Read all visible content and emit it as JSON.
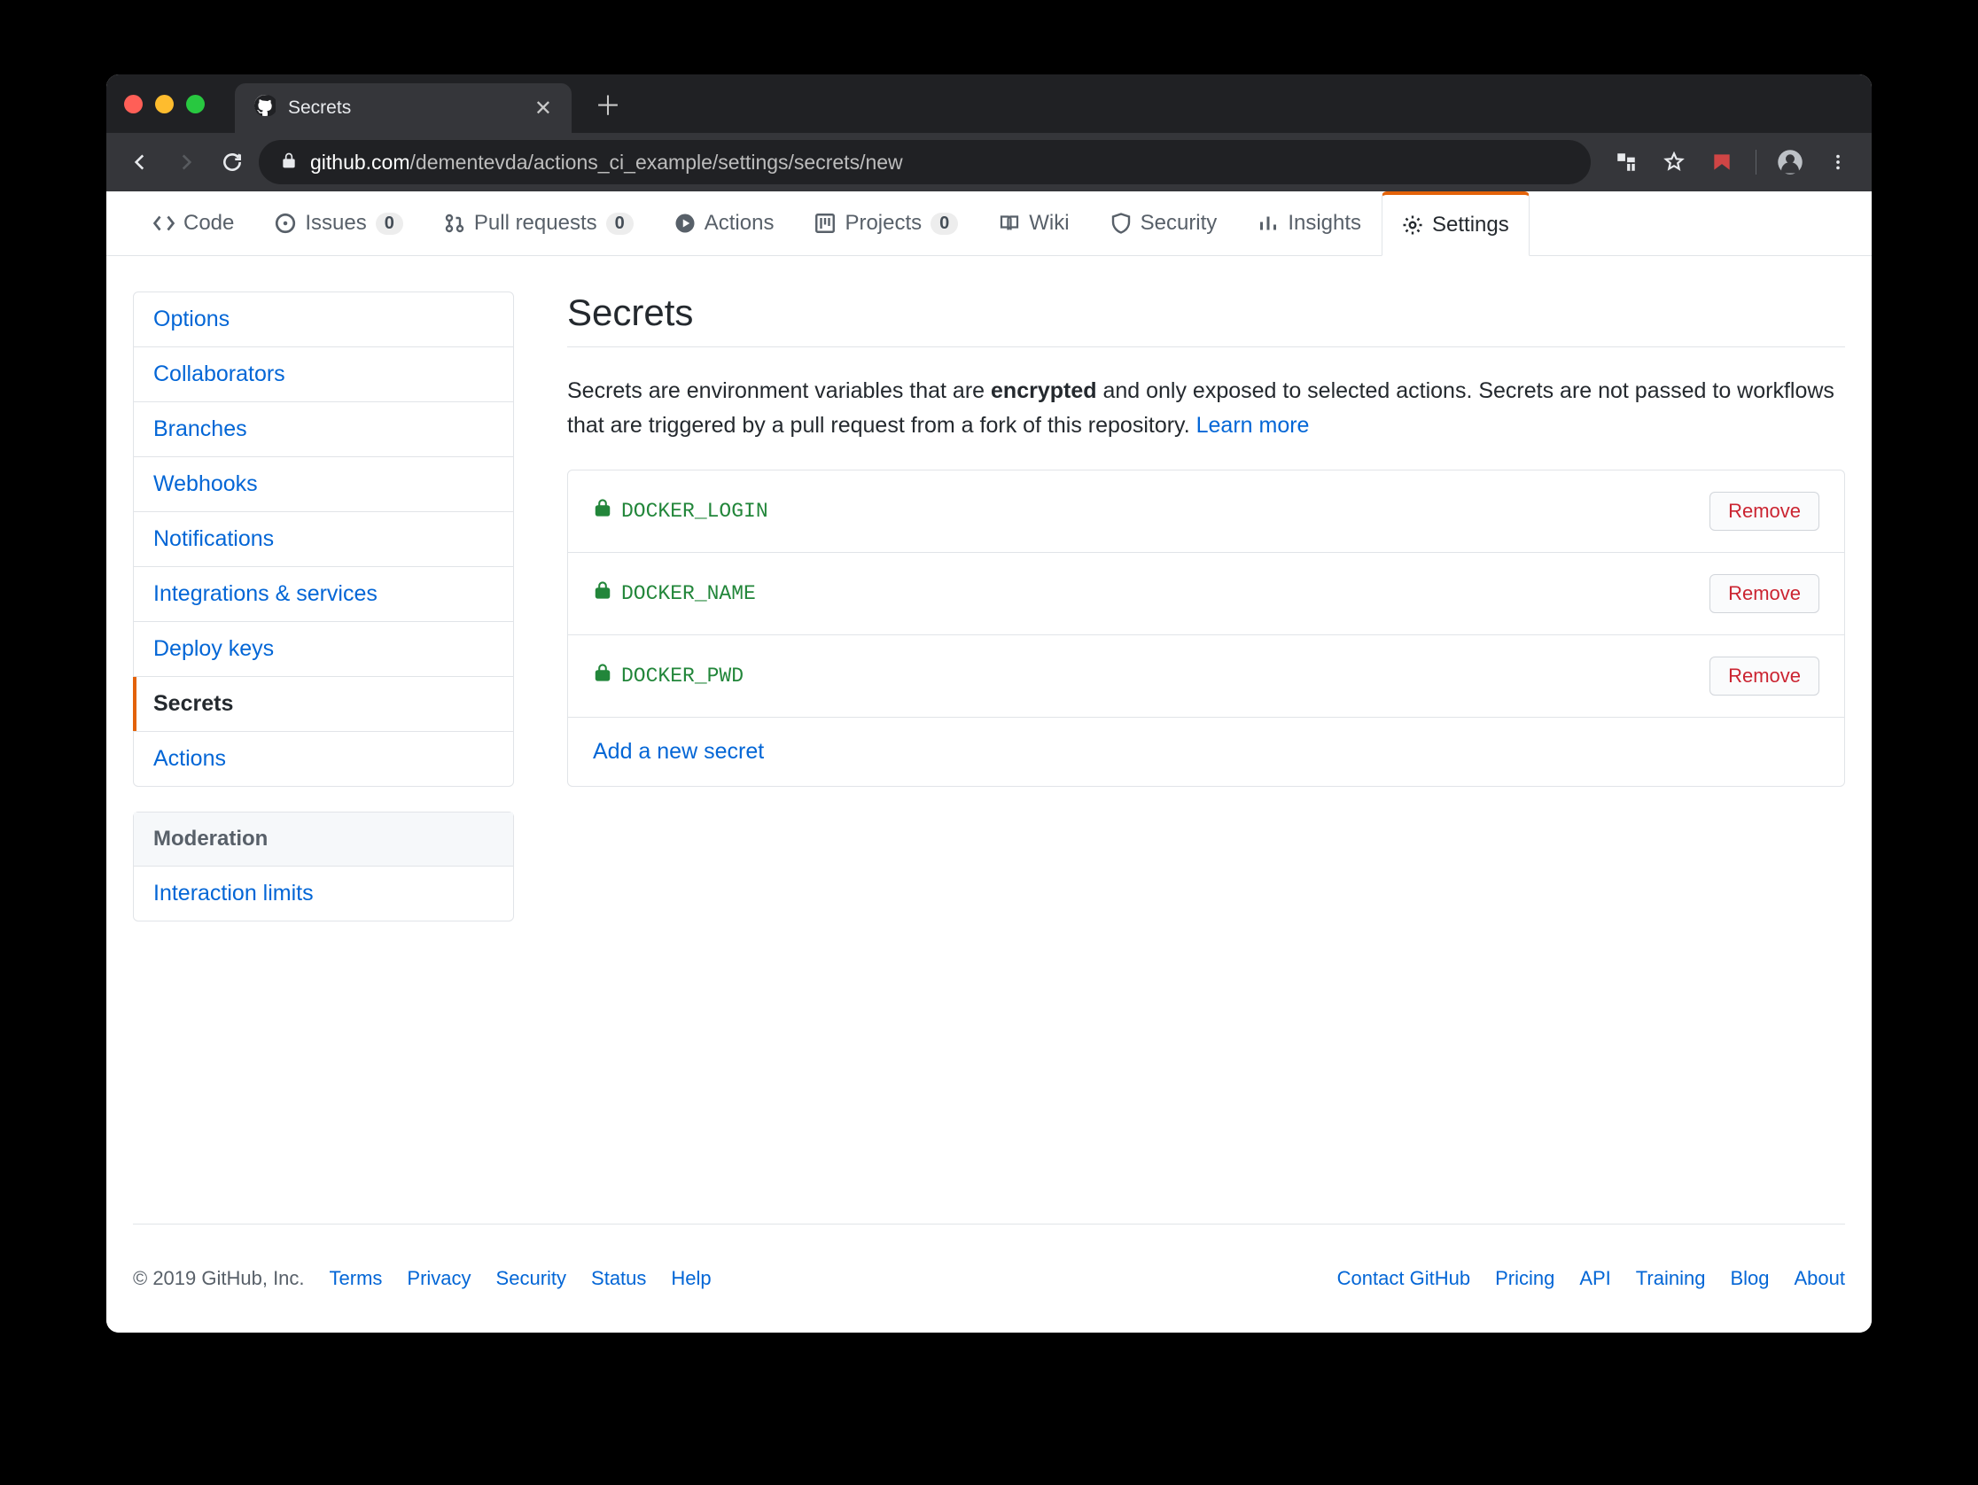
{
  "browser": {
    "tab_title": "Secrets",
    "url_host": "github.com",
    "url_path": "/dementevda/actions_ci_example/settings/secrets/new"
  },
  "reponav": [
    {
      "icon": "code",
      "label": "Code"
    },
    {
      "icon": "issue",
      "label": "Issues",
      "count": "0"
    },
    {
      "icon": "pr",
      "label": "Pull requests",
      "count": "0"
    },
    {
      "icon": "play",
      "label": "Actions"
    },
    {
      "icon": "project",
      "label": "Projects",
      "count": "0"
    },
    {
      "icon": "book",
      "label": "Wiki"
    },
    {
      "icon": "shield",
      "label": "Security"
    },
    {
      "icon": "graph",
      "label": "Insights"
    },
    {
      "icon": "gear",
      "label": "Settings",
      "active": true
    }
  ],
  "sidebar": {
    "items": [
      "Options",
      "Collaborators",
      "Branches",
      "Webhooks",
      "Notifications",
      "Integrations & services",
      "Deploy keys",
      "Secrets",
      "Actions"
    ],
    "selected": "Secrets",
    "moderation_header": "Moderation",
    "moderation_items": [
      "Interaction limits"
    ]
  },
  "main": {
    "title": "Secrets",
    "desc_pre": "Secrets are environment variables that are ",
    "desc_strong": "encrypted",
    "desc_post": " and only exposed to selected actions. Secrets are not passed to workflows that are triggered by a pull request from a fork of this repository. ",
    "learn_more": "Learn more",
    "secrets": [
      {
        "name": "DOCKER_LOGIN",
        "remove": "Remove"
      },
      {
        "name": "DOCKER_NAME",
        "remove": "Remove"
      },
      {
        "name": "DOCKER_PWD",
        "remove": "Remove"
      }
    ],
    "add_label": "Add a new secret"
  },
  "footer": {
    "copyright": "© 2019 GitHub, Inc.",
    "left": [
      "Terms",
      "Privacy",
      "Security",
      "Status",
      "Help"
    ],
    "right": [
      "Contact GitHub",
      "Pricing",
      "API",
      "Training",
      "Blog",
      "About"
    ]
  }
}
